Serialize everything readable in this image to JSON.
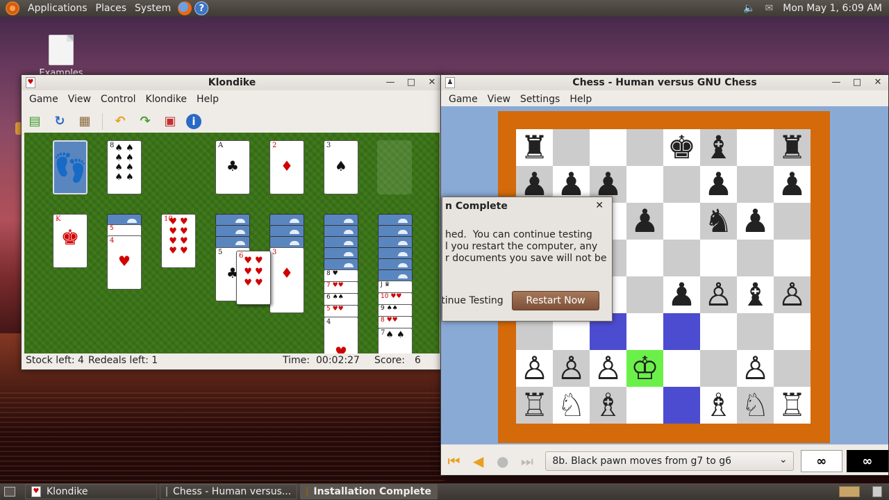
{
  "top_panel": {
    "menus": [
      "Applications",
      "Places",
      "System"
    ],
    "clock": "Mon May  1,  6:09 AM"
  },
  "desktop": {
    "icon_label": "Examples"
  },
  "klondike": {
    "title": "Klondike",
    "menus": [
      "Game",
      "View",
      "Control",
      "Klondike",
      "Help"
    ],
    "toolbar": [
      "new-game",
      "restart",
      "hint",
      "undo",
      "redo",
      "deal",
      "info"
    ],
    "foundations": [
      {
        "rank": "A",
        "suit": "♣",
        "color": "black"
      },
      {
        "rank": "2",
        "suit": "♦",
        "color": "red"
      },
      {
        "rank": "3",
        "suit": "♠",
        "color": "black"
      }
    ],
    "waste_card": {
      "rank": "8",
      "suit": "♠",
      "color": "black"
    },
    "tableau_faces": {
      "col1": {
        "rank": "K",
        "suit": "♥"
      },
      "col2": {
        "rank": "5",
        "under": "4",
        "suit": "♥"
      },
      "col3": {
        "rank": "10",
        "suit": "♥"
      },
      "col4": {
        "rank": "5",
        "suit": "♣"
      },
      "dragged": {
        "rank": "6",
        "suit": "♥"
      },
      "col5": {
        "rank": "3",
        "suit": "♦"
      },
      "col6": [
        "8",
        "7",
        "6",
        "5",
        "4"
      ],
      "col7": [
        "J",
        "10",
        "9",
        "8",
        "7"
      ]
    },
    "status": {
      "stock": "Stock left: 4",
      "redeals": "Redeals left: 1",
      "time_label": "Time:",
      "time": "00:02:27",
      "score_label": "Score:",
      "score": "6"
    }
  },
  "chess": {
    "title": "Chess - Human versus GNU Chess",
    "menus": [
      "Game",
      "View",
      "Settings",
      "Help"
    ],
    "board": [
      [
        "♜",
        "",
        "",
        "",
        "♚",
        "♝",
        "",
        "♜"
      ],
      [
        "♟",
        "♟",
        "♟",
        "",
        "",
        "♟",
        "",
        "♟"
      ],
      [
        "",
        "",
        "",
        "♟",
        "",
        "♞",
        "♟",
        ""
      ],
      [
        "",
        "",
        "",
        "",
        "",
        "",
        "",
        ""
      ],
      [
        "",
        "",
        "",
        "",
        "♟",
        "♙",
        "♝",
        "♙"
      ],
      [
        "",
        "",
        "",
        "",
        "",
        "",
        "",
        ""
      ],
      [
        "♙",
        "♙",
        "♙",
        "♔",
        "",
        "",
        "♙",
        ""
      ],
      [
        "♖",
        "♘",
        "♗",
        "",
        "",
        "♗",
        "♘",
        "♖"
      ]
    ],
    "move": "8b. Black pawn moves from g7 to g6",
    "white_clock": "∞",
    "black_clock": "∞"
  },
  "dialog": {
    "title": "n Complete",
    "body": "hed.  You can continue testing\nl you restart the computer, any\nr documents you save will not be",
    "continue": "tinue Testing",
    "restart": "Restart Now"
  },
  "bottom_panel": {
    "tasks": [
      "Klondike",
      "Chess - Human versus...",
      "Installation Complete"
    ]
  }
}
